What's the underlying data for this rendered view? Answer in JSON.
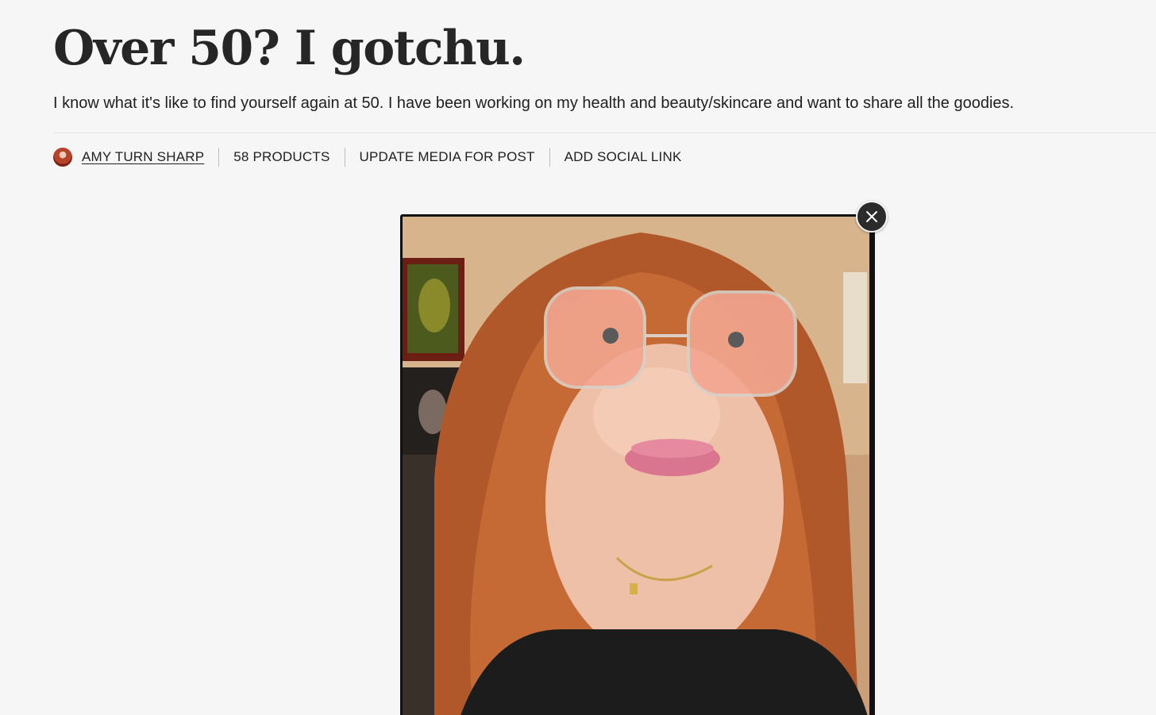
{
  "header": {
    "title": "Over 50? I gotchu.",
    "description": "I know what it's like to find yourself again at 50. I have been working on my health and beauty/skincare and want to share all the goodies."
  },
  "meta": {
    "author": "AMY TURN SHARP",
    "products": "58 PRODUCTS",
    "update_media": "UPDATE MEDIA FOR POST",
    "add_social": "ADD SOCIAL LINK"
  },
  "media": {
    "alt": "Selfie of a woman with long red hair and pink tinted glasses",
    "close_icon": "close-icon"
  },
  "colors": {
    "background": "#f6f6f6",
    "text": "#1f1f1f",
    "close_button": "#2b2b2b"
  }
}
